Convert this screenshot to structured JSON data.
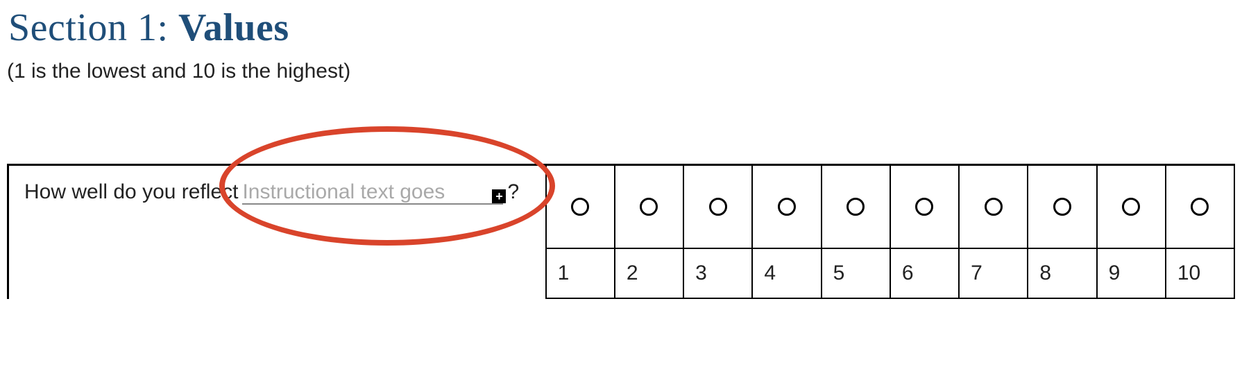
{
  "heading": {
    "prefix": "Section 1: ",
    "bold": "Values"
  },
  "subtitle": "(1 is the lowest and 10 is the highest)",
  "question": {
    "before": "How well do you reflect ",
    "placeholder": "Instructional text goes",
    "after": "?"
  },
  "rating": {
    "labels": [
      "1",
      "2",
      "3",
      "4",
      "5",
      "6",
      "7",
      "8",
      "9",
      "10"
    ]
  },
  "icons": {
    "plus": "+"
  }
}
